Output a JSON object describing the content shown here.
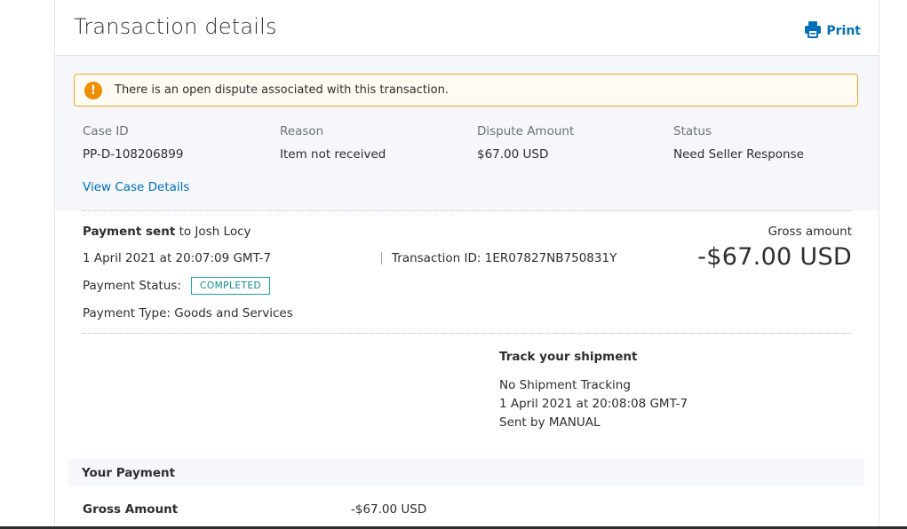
{
  "header": {
    "title": "Transaction details",
    "print_label": "Print"
  },
  "alert": {
    "icon": "!",
    "message": "There is an open dispute associated with this transaction."
  },
  "dispute": {
    "columns": [
      "Case ID",
      "Reason",
      "Dispute Amount",
      "Status"
    ],
    "values": [
      "PP-D-108206899",
      "Item not received",
      "$67.00 USD",
      "Need Seller Response"
    ],
    "link": "View Case Details"
  },
  "payment": {
    "sent_bold": "Payment sent",
    "sent_rest": " to Josh Locy",
    "datetime": "1 April 2021 at 20:07:09 GMT-7",
    "transaction_id": "Transaction ID: 1ER07827NB750831Y",
    "status_label": "Payment Status:",
    "status_badge": "COMPLETED",
    "type": "Payment Type: Goods and Services",
    "gross_label": "Gross amount",
    "gross_amount": "-$67.00 USD"
  },
  "shipment": {
    "title": "Track your shipment",
    "line1": "No Shipment Tracking",
    "line2": "1 April 2021 at 20:08:08 GMT-7",
    "line3": "Sent by MANUAL"
  },
  "your_payment": {
    "title": "Your Payment",
    "gross_label": "Gross Amount",
    "gross_value": "-$67.00 USD"
  },
  "colors": {
    "link": "#0070ba",
    "warning": "#f08c00",
    "badge": "#18a4a9"
  }
}
